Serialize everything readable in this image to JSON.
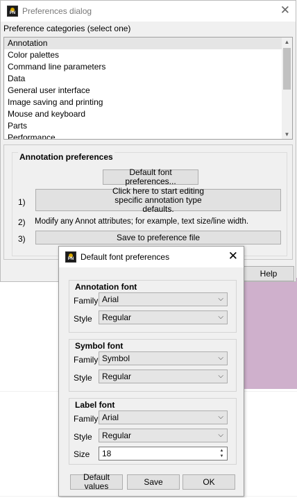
{
  "preferences_dialog": {
    "title": "Preferences dialog",
    "categories_label": "Preference categories (select one)",
    "categories": [
      {
        "label": "Annotation",
        "selected": true
      },
      {
        "label": "Color palettes",
        "selected": false
      },
      {
        "label": "Command line parameters",
        "selected": false
      },
      {
        "label": "Data",
        "selected": false
      },
      {
        "label": "General user interface",
        "selected": false
      },
      {
        "label": "Image saving and printing",
        "selected": false
      },
      {
        "label": "Mouse and keyboard",
        "selected": false
      },
      {
        "label": "Parts",
        "selected": false
      },
      {
        "label": "Performance",
        "selected": false
      }
    ],
    "annotation": {
      "heading": "Annotation preferences",
      "default_font_button": "Default font preferences...",
      "step1_num": "1)",
      "step1_button": "Click here to start editing specific annotation type defaults.",
      "step2_num": "2)",
      "step2_text": "Modify any Annot attributes; for example, text size/line width.",
      "step3_num": "3)",
      "step3_button": "Save to preference file"
    },
    "help_button": "Help"
  },
  "font_dialog": {
    "title": "Default font preferences",
    "groups": {
      "annotation": {
        "title": "Annotation font",
        "family_label": "Family",
        "family": "Arial",
        "style_label": "Style",
        "style": "Regular"
      },
      "symbol": {
        "title": "Symbol font",
        "family_label": "Family",
        "family": "Symbol",
        "style_label": "Style",
        "style": "Regular"
      },
      "label": {
        "title": "Label font",
        "family_label": "Family",
        "family": "Arial",
        "style_label": "Style",
        "style": "Regular",
        "size_label": "Size",
        "size": "18"
      }
    },
    "buttons": {
      "default_values": "Default values",
      "save": "Save",
      "ok": "OK"
    }
  },
  "icons": {
    "app": "app-logo-icon",
    "close": "close-icon",
    "dropdown": "chevron-down-icon"
  },
  "colors": {
    "background_accent": "#cfb0cc",
    "selected_item": "#e5e5e5",
    "dialog_bg": "#f0f0f0"
  }
}
